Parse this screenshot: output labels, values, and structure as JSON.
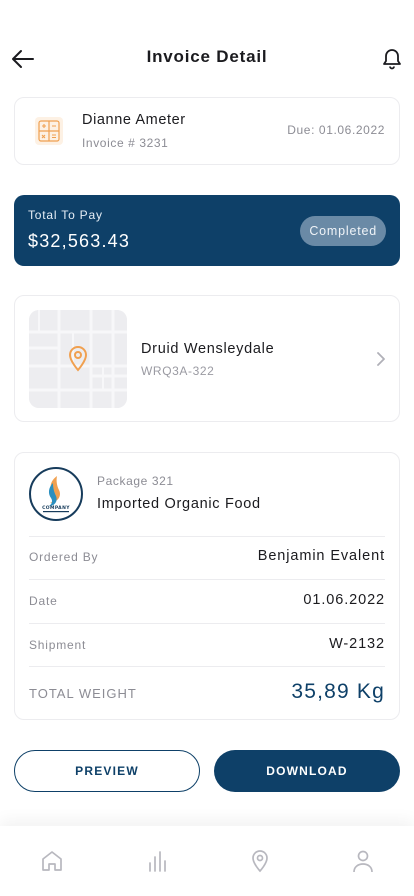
{
  "header": {
    "title": "Invoice Detail",
    "back_icon": "arrow-left-icon",
    "notif_icon": "bell-icon"
  },
  "invoice": {
    "name": "Dianne Ameter",
    "number": "Invoice # 3231",
    "due": "Due: 01.06.2022",
    "icon": "calculator-icon"
  },
  "payment": {
    "label": "Total To Pay",
    "amount": "$32,563.43",
    "status": "Completed"
  },
  "location": {
    "name": "Druid Wensleydale",
    "code": "WRQ3A-322",
    "icon": "map-pin-icon"
  },
  "package": {
    "number": "Package 321",
    "name": "Imported Organic Food",
    "logo_text": "COMPANY",
    "rows": [
      {
        "label": "Ordered By",
        "value": "Benjamin Evalent"
      },
      {
        "label": "Date",
        "value": "01.06.2022"
      },
      {
        "label": "Shipment",
        "value": "W-2132"
      }
    ],
    "total_weight_label": "TOTAL WEIGHT",
    "total_weight_value": "35,89 Kg"
  },
  "actions": {
    "preview": "PREVIEW",
    "download": "DOWNLOAD"
  },
  "tabbar": {
    "items": [
      "home-icon",
      "stats-icon",
      "location-icon",
      "profile-icon"
    ]
  },
  "colors": {
    "primary": "#0e4068",
    "accent": "#f0a050",
    "badge": "#6a8aa6"
  }
}
